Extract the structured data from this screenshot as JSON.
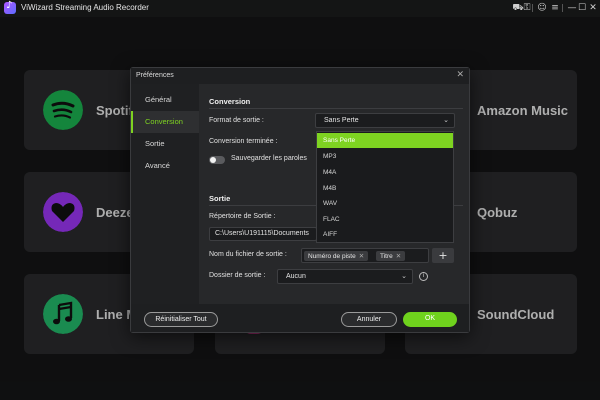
{
  "app": {
    "title": "ViWizard Streaming Audio Recorder"
  },
  "titlebar": {
    "icons": [
      "cart-icon",
      "key-icon",
      "user-icon",
      "menu-icon",
      "minimize-icon",
      "maximize-icon",
      "close-icon"
    ],
    "glyphs": {
      "cart": "⛟",
      "key": "⚿",
      "user": "☺",
      "menu": "≡",
      "minimize": "—",
      "maximize": "☐",
      "close": "✕"
    }
  },
  "services": {
    "spotify": "Spotify",
    "amazon": "Amazon Music",
    "deezer": "Deezer",
    "qobuz": "Qobuz",
    "line": "Line Music",
    "soundcloud": "SoundCloud",
    "colors": {
      "spotify": "#1db954",
      "deezer": "#a238ff",
      "line": "#25c16f"
    }
  },
  "dialog": {
    "title": "Préférences",
    "close_glyph": "✕",
    "nav": [
      {
        "label": "Général"
      },
      {
        "label": "Conversion"
      },
      {
        "label": "Sortie"
      },
      {
        "label": "Avancé"
      }
    ],
    "active_nav": "Conversion",
    "conversion": {
      "heading": "Conversion",
      "format_label": "Format de sortie :",
      "format_value": "Sans Perte",
      "done_label": "Conversion terminée :",
      "lyrics_label": "Sauvegarder les paroles"
    },
    "output": {
      "heading": "Sortie",
      "dir_label": "Répertoire de Sortie :",
      "dir_value": "C:\\Users\\U191115\\Documents",
      "filename_label": "Nom du fichier de sortie :",
      "tags": [
        "Numéro de piste",
        "Titre"
      ],
      "tag_remove_glyph": "✕",
      "add_glyph": "+",
      "folder_label": "Dossier de sortie :",
      "folder_value": "Aucun",
      "info_glyph": "i"
    },
    "footer": {
      "reset_label": "Réinitialiser Tout",
      "cancel_label": "Annuler",
      "ok_label": "OK"
    },
    "chevron_glyph": "⌄"
  },
  "format_dropdown": {
    "options": [
      "Sans Perte",
      "MP3",
      "M4A",
      "M4B",
      "WAV",
      "FLAC",
      "AIFF"
    ],
    "selected": "Sans Perte"
  },
  "accent_color": "#7ed321"
}
